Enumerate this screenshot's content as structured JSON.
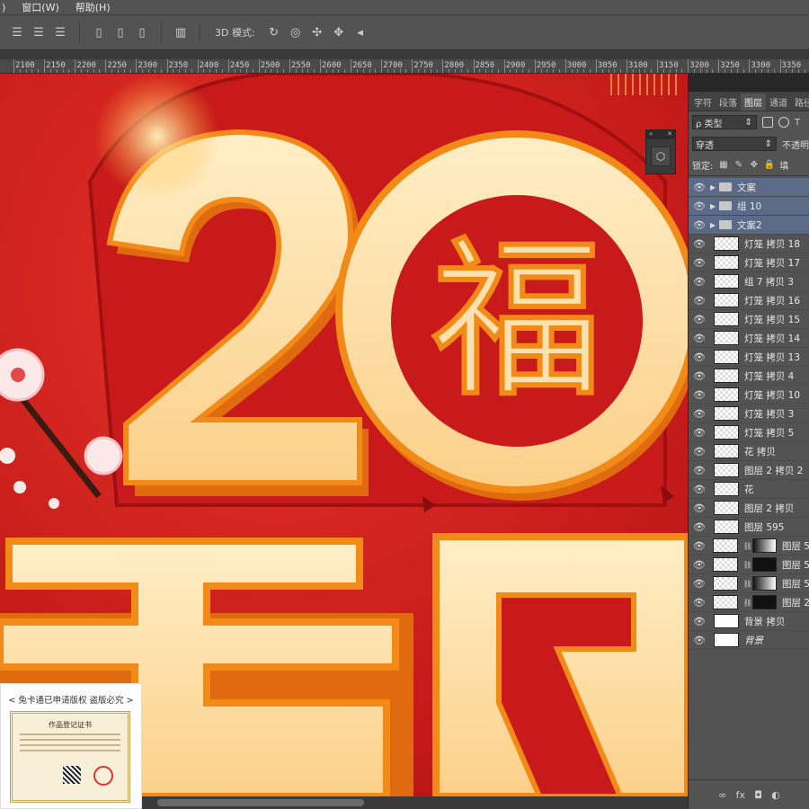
{
  "menu": {
    "items": [
      ")",
      "窗口(W)",
      "帮助(H)"
    ]
  },
  "options": {
    "label_3d": "3D 模式:"
  },
  "ruler": {
    "labels": [
      "2100",
      "2150",
      "2200",
      "2250",
      "2300",
      "2350",
      "2400",
      "2450",
      "2500",
      "2550",
      "2600",
      "2650",
      "2700",
      "2750",
      "2800",
      "2850",
      "2900",
      "2950",
      "3000",
      "3050",
      "3100",
      "3150",
      "3200",
      "3250",
      "3300",
      "3350"
    ]
  },
  "panel": {
    "tabs": [
      "字符",
      "段落",
      "图层",
      "通道",
      "路径"
    ],
    "active_tab": "图层",
    "filter_label": "ρ 类型",
    "blend_mode": "穿透",
    "opacity_label": "不透明",
    "lock_label": "锁定:",
    "fill_label": "填"
  },
  "layers": [
    {
      "name": "文案",
      "kind": "folder",
      "selected": true
    },
    {
      "name": "组 10",
      "kind": "folder",
      "selected": true
    },
    {
      "name": "文案2",
      "kind": "folder",
      "selected": true
    },
    {
      "name": "灯笼 拷贝 18",
      "kind": "layer"
    },
    {
      "name": "灯笼 拷贝 17",
      "kind": "layer"
    },
    {
      "name": "组 7 拷贝 3",
      "kind": "layer"
    },
    {
      "name": "灯笼 拷贝 16",
      "kind": "layer"
    },
    {
      "name": "灯笼 拷贝 15",
      "kind": "layer"
    },
    {
      "name": "灯笼 拷贝 14",
      "kind": "layer"
    },
    {
      "name": "灯笼 拷贝 13",
      "kind": "layer"
    },
    {
      "name": "灯笼 拷贝 4",
      "kind": "layer"
    },
    {
      "name": "灯笼 拷贝 10",
      "kind": "layer"
    },
    {
      "name": "灯笼 拷贝 3",
      "kind": "layer"
    },
    {
      "name": "灯笼 拷贝 5",
      "kind": "layer"
    },
    {
      "name": "花 拷贝",
      "kind": "layer"
    },
    {
      "name": "图层 2 拷贝 2",
      "kind": "layer"
    },
    {
      "name": "花",
      "kind": "layer"
    },
    {
      "name": "图层 2 拷贝",
      "kind": "layer"
    },
    {
      "name": "图层 595",
      "kind": "layer"
    },
    {
      "name": "图层 5",
      "kind": "masked"
    },
    {
      "name": "图层 5",
      "kind": "masked"
    },
    {
      "name": "图层 5",
      "kind": "masked"
    },
    {
      "name": "图层 2",
      "kind": "masked"
    },
    {
      "name": "背景 拷贝",
      "kind": "white"
    },
    {
      "name": "背景",
      "kind": "white",
      "italic": true
    }
  ],
  "footer_icons": [
    "∞",
    "fx",
    "◘",
    "◐"
  ],
  "watermark": {
    "text": "< 兔卡通已申请版权 盗版必究 >",
    "cert_title": "作品登记证书"
  },
  "colors": {
    "canvas_red": "#d61f1f",
    "glyph_fill": "#fde2b0",
    "glyph_edge": "#f28a17",
    "panel_bg": "#535353",
    "selected_row": "#5b6a86"
  }
}
